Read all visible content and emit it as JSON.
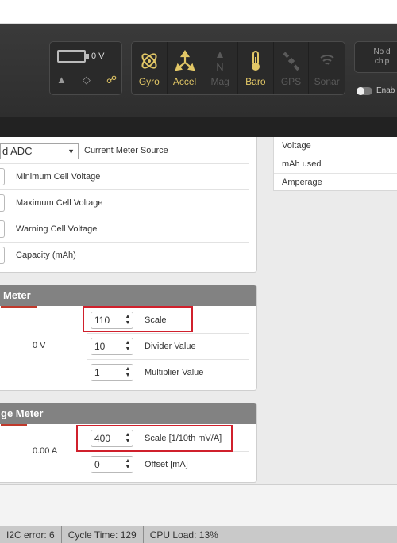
{
  "header": {
    "battery": {
      "voltage": "0 V"
    },
    "sensors": [
      {
        "name": "Gyro",
        "icon": "gyro-icon",
        "active": true
      },
      {
        "name": "Accel",
        "icon": "accel-icon",
        "active": true
      },
      {
        "name": "Mag",
        "icon": "mag-icon",
        "active": false
      },
      {
        "name": "Baro",
        "icon": "baro-icon",
        "active": true
      },
      {
        "name": "GPS",
        "icon": "gps-icon",
        "active": false
      },
      {
        "name": "Sonar",
        "icon": "sonar-icon",
        "active": false
      }
    ],
    "no_device_line1": "No d",
    "no_device_line2": "chip",
    "enable_label": "Enab"
  },
  "battery_panel": {
    "meter_source_value": "d ADC",
    "meter_source_label": "Current Meter Source",
    "rows": [
      {
        "label": "Minimum Cell Voltage"
      },
      {
        "label": "Maximum Cell Voltage"
      },
      {
        "label": "Warning Cell Voltage"
      },
      {
        "label": "Capacity (mAh)"
      }
    ]
  },
  "voltage_panel": {
    "title": "Meter",
    "reading": "0 V",
    "rows": [
      {
        "value": "110",
        "label": "Scale"
      },
      {
        "value": "10",
        "label": "Divider Value"
      },
      {
        "value": "1",
        "label": "Multiplier Value"
      }
    ]
  },
  "amperage_panel": {
    "title": "ge Meter",
    "reading": "0.00 A",
    "rows": [
      {
        "value": "400",
        "label": "Scale [1/10th mV/A]"
      },
      {
        "value": "0",
        "label": "Offset [mA]"
      }
    ]
  },
  "right_panel": {
    "rows": [
      "Voltage",
      "mAh used",
      "Amperage"
    ]
  },
  "status_bar": {
    "i2c": "I2C error: 6",
    "cycle": "Cycle Time: 129",
    "cpu": "CPU Load: 13%"
  },
  "colors": {
    "accent": "#e2c766",
    "highlight": "#d0202c",
    "panel_header": "#828282"
  }
}
